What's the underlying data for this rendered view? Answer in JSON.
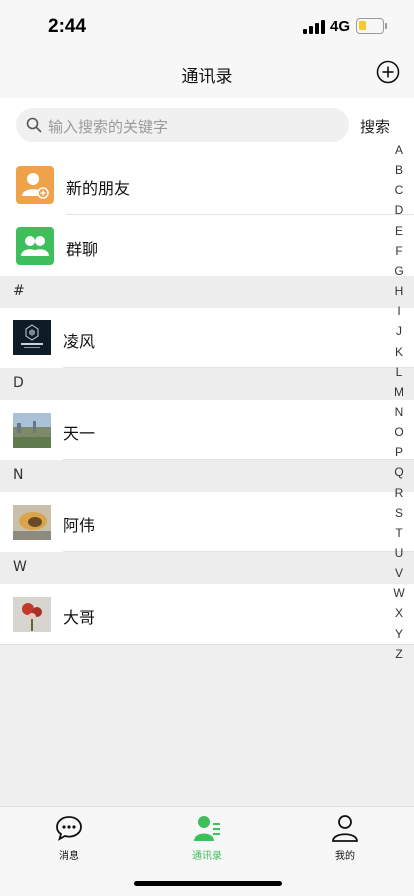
{
  "status_bar": {
    "time": "2:44",
    "network": "4G",
    "battery_level": 0.25,
    "battery_color": "#f5c92a"
  },
  "header": {
    "title": "通讯录",
    "add_icon": "plus-circle-icon"
  },
  "search": {
    "placeholder": "输入搜索的关键字",
    "button_label": "搜索"
  },
  "function_items": [
    {
      "label": "新的朋友",
      "icon": "add-friend-icon",
      "color": "#f0a24a"
    },
    {
      "label": "群聊",
      "icon": "group-chat-icon",
      "color": "#3fbf5c"
    }
  ],
  "sections": [
    {
      "letter": "#",
      "contacts": [
        {
          "name": "凌风",
          "avatar": "ingress-logo-avatar"
        }
      ]
    },
    {
      "letter": "D",
      "contacts": [
        {
          "name": "天一",
          "avatar": "landscape-photo-avatar"
        }
      ]
    },
    {
      "letter": "N",
      "contacts": [
        {
          "name": "阿伟",
          "avatar": "sculpture-photo-avatar"
        }
      ]
    },
    {
      "letter": "W",
      "contacts": [
        {
          "name": "大哥",
          "avatar": "flowers-photo-avatar"
        }
      ]
    }
  ],
  "index_letters": [
    "A",
    "B",
    "C",
    "D",
    "E",
    "F",
    "G",
    "H",
    "I",
    "J",
    "K",
    "L",
    "M",
    "N",
    "O",
    "P",
    "Q",
    "R",
    "S",
    "T",
    "U",
    "V",
    "W",
    "X",
    "Y",
    "Z"
  ],
  "tabs": [
    {
      "label": "消息",
      "icon": "chat-bubble-icon",
      "active": false
    },
    {
      "label": "通讯录",
      "icon": "contacts-icon",
      "active": true
    },
    {
      "label": "我的",
      "icon": "profile-icon",
      "active": false
    }
  ],
  "colors": {
    "accent": "#3fbf5c",
    "orange": "#f0a24a"
  }
}
